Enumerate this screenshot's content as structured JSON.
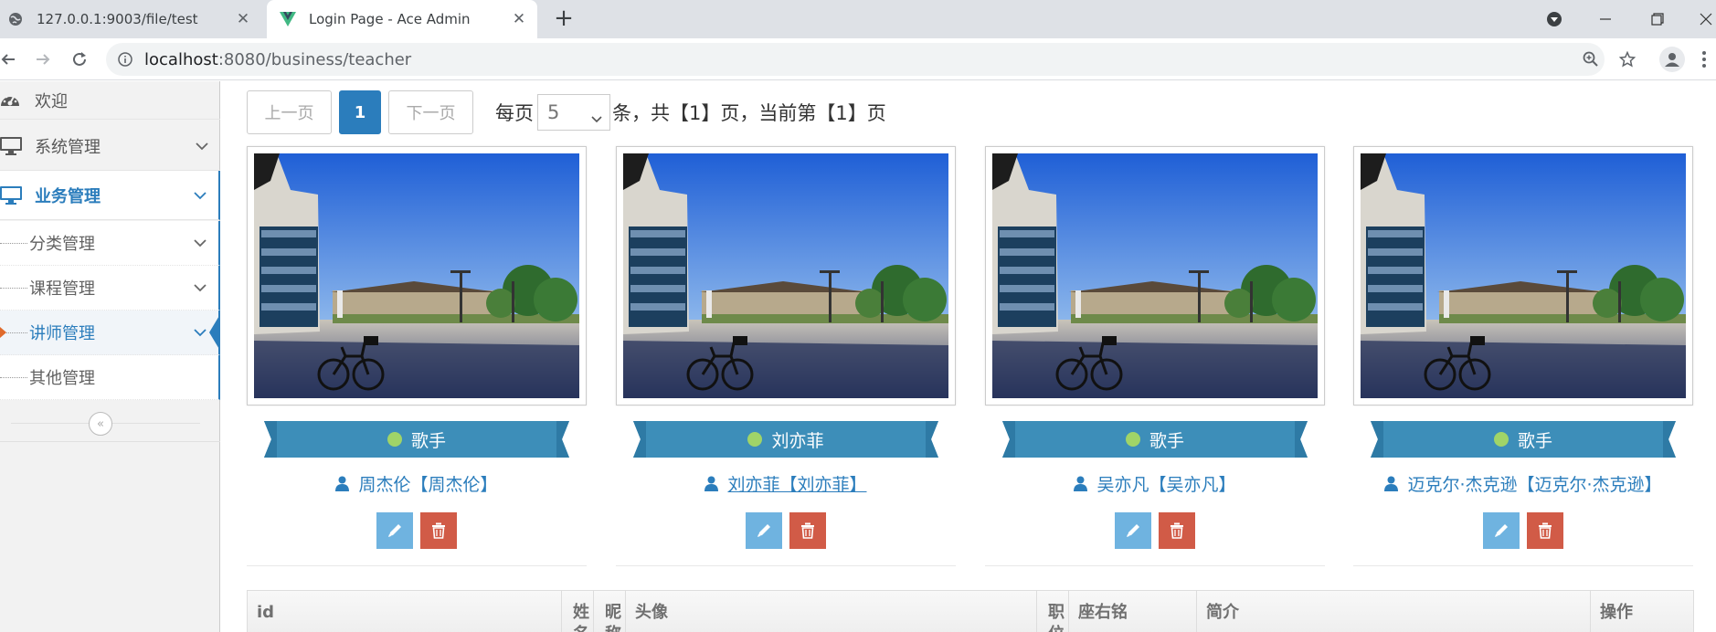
{
  "browser": {
    "tabs": [
      {
        "title": "127.0.0.1:9003/file/test",
        "active": false,
        "favicon": "globe-icon"
      },
      {
        "title": "Login Page - Ace Admin",
        "active": true,
        "favicon": "vue-logo-icon"
      }
    ],
    "url_host": "localhost",
    "url_path": ":8080/business/teacher"
  },
  "sidebar": {
    "welcome": "欢迎",
    "system": "系统管理",
    "business": "业务管理",
    "sub_items": [
      "分类管理",
      "课程管理",
      "讲师管理",
      "其他管理"
    ],
    "active_sub": "讲师管理"
  },
  "pager": {
    "prev": "上一页",
    "current": "1",
    "next": "下一页",
    "per_page_label": "每页",
    "page_size": "5",
    "summary": "条，共【1】页，当前第【1】页"
  },
  "teachers": [
    {
      "position": "歌手",
      "name": "周杰伦【周杰伦】",
      "hover": false
    },
    {
      "position": "刘亦菲",
      "name": "刘亦菲【刘亦菲】",
      "hover": true
    },
    {
      "position": "歌手",
      "name": "吴亦凡【吴亦凡】",
      "hover": false
    },
    {
      "position": "歌手",
      "name": "迈克尔·杰克逊【迈克尔·杰克逊】",
      "hover": false
    }
  ],
  "table": {
    "headers": [
      "id",
      "姓名",
      "昵称",
      "头像",
      "职位",
      "座右铭",
      "简介",
      "操作"
    ]
  },
  "colors": {
    "primary": "#2b7dbc",
    "ribbon": "#3d8eb9",
    "dot": "#a0d468",
    "edit": "#6fb3e0",
    "delete": "#d15b47"
  }
}
